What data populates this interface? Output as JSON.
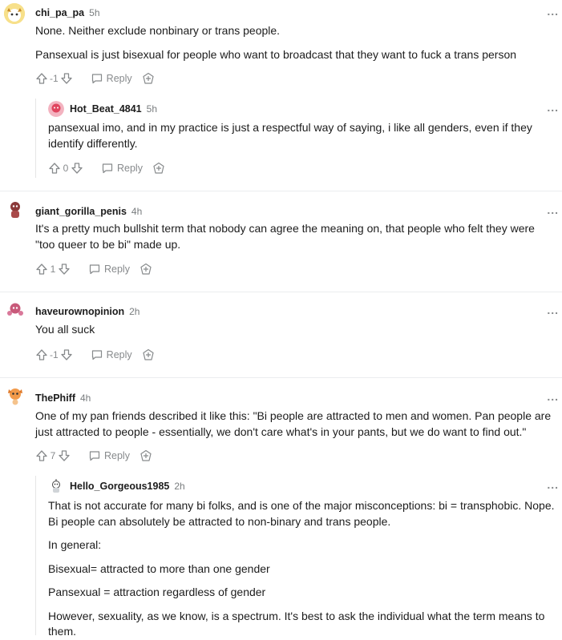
{
  "comments": [
    {
      "username": "chi_pa_pa",
      "time": "5h",
      "paragraphs": [
        "None. Neither exclude nonbinary or trans people.",
        "Pansexual is just bisexual for people who want to broadcast that they want to fuck a trans person"
      ],
      "score": "-1",
      "reply_label": "Reply",
      "replies": [
        {
          "username": "Hot_Beat_4841",
          "time": "5h",
          "paragraphs": [
            "pansexual imo, and in my practice is just a respectful way of saying, i like all genders, even if they identify differently."
          ],
          "score": "0",
          "reply_label": "Reply"
        }
      ]
    },
    {
      "username": "giant_gorilla_penis",
      "time": "4h",
      "paragraphs": [
        "It's a pretty much bullshit term that nobody can agree the meaning on, that people who felt they were \"too queer to be bi\" made up."
      ],
      "score": "1",
      "reply_label": "Reply"
    },
    {
      "username": "haveurownopinion",
      "time": "2h",
      "paragraphs": [
        "You all suck"
      ],
      "score": "-1",
      "reply_label": "Reply"
    },
    {
      "username": "ThePhiff",
      "time": "4h",
      "paragraphs": [
        "One of my pan friends described it like this: \"Bi people are attracted to men and women. Pan people are just attracted to people - essentially, we don't care what's in your pants, but we do want to find out.\""
      ],
      "score": "7",
      "reply_label": "Reply",
      "replies": [
        {
          "username": "Hello_Gorgeous1985",
          "time": "2h",
          "paragraphs": [
            "That is not accurate for many bi folks, and is one of the major misconceptions: bi = transphobic. Nope. Bi people can absolutely be attracted to non-binary and trans people.",
            "In general:",
            "Bisexual= attracted to more than one gender",
            "Pansexual = attraction regardless of gender",
            "However, sexuality, as we know, is a spectrum. It's best to ask the individual what the term means to them."
          ]
        }
      ]
    }
  ],
  "more_label": "..."
}
